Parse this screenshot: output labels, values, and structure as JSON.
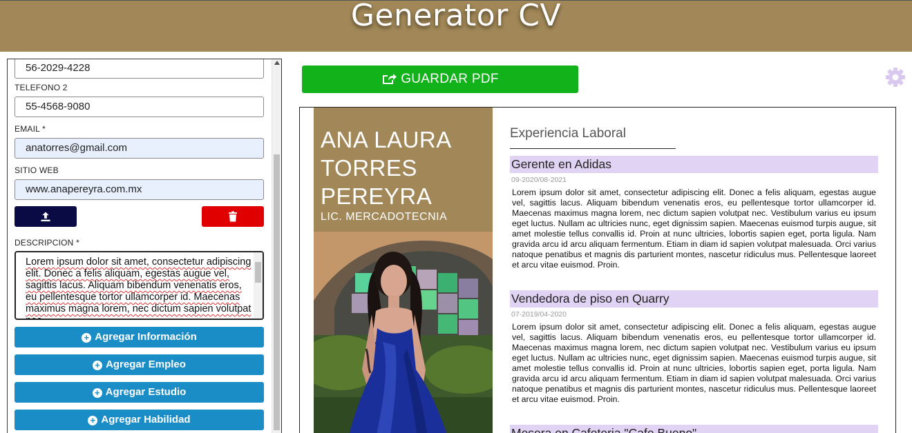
{
  "header": {
    "title": "Generator CV"
  },
  "form": {
    "phone1_value": "56-2029-4228",
    "phone2_label": "TELEFONO 2",
    "phone2_value": "55-4568-9080",
    "email_label": "EMAIL *",
    "email_value": "anatorres@gmail.com",
    "website_label": "SITIO WEB",
    "website_value": "www.anapereyra.com.mx",
    "description_label": "DESCRIPCION *",
    "description_value": "Lorem ipsum dolor sit amet, consectetur adipiscing elit. Donec a felis aliquam, egestas augue vel, sagittis lacus. Aliquam bibendum venenatis eros, eu pellentesque tortor ullamcorper id. Maecenas maximus magna lorem, nec dictum sapien volutpat nec.",
    "upload_icon": "upload-icon",
    "delete_icon": "trash-icon",
    "buttons": {
      "add_info": "Agregar Información",
      "add_job": "Agregar Empleo",
      "add_study": "Agregar Estudio",
      "add_skill": "Agregar Habilidad"
    }
  },
  "toolbar": {
    "pdf_label": "GUARDAR PDF",
    "pdf_icon": "share-icon",
    "settings_icon": "gear-icon"
  },
  "colors": {
    "header": "#a28858",
    "pdf_button": "#12b21a",
    "add_button": "#1a8dc6",
    "upload_button": "#0a0a45",
    "delete_button": "#e00000",
    "job_highlight": "#e1d3f3",
    "settings_gear": "#d9c8f0"
  },
  "cv": {
    "name_line1": "ANA LAURA",
    "name_line2": "TORRES",
    "name_line3": "PEREYRA",
    "degree": "LIC. MERCADOTECNIA",
    "experience_title": "Experiencia Laboral",
    "jobs": [
      {
        "title": "Gerente en Adidas",
        "dates": "09-2020/08-2021",
        "description": "Lorem ipsum dolor sit amet, consectetur adipiscing elit. Donec a felis aliquam, egestas augue vel, sagittis lacus. Aliquam bibendum venenatis eros, eu pellentesque tortor ullamcorper id. Maecenas maximus magna lorem, nec dictum sapien volutpat nec. Vestibulum varius eu ipsum eget luctus. Nullam ac ultricies nunc, eget dignissim sapien. Maecenas euismod turpis augue, sit amet molestie tellus convallis id. Proin at nunc ultricies, lobortis sapien eget, porta ligula. Nam gravida arcu id arcu aliquam fermentum. Etiam in diam id sapien volutpat malesuada. Orci varius natoque penatibus et magnis dis parturient montes, nascetur ridiculus mus. Pellentesque laoreet et arcu vitae euismod. Proin."
      },
      {
        "title": "Vendedora de piso en Quarry",
        "dates": "07-2019/04-2020",
        "description": "Lorem ipsum dolor sit amet, consectetur adipiscing elit. Donec a felis aliquam, egestas augue vel, sagittis lacus. Aliquam bibendum venenatis eros, eu pellentesque tortor ullamcorper id. Maecenas maximus magna lorem, nec dictum sapien volutpat nec. Vestibulum varius eu ipsum eget luctus. Nullam ac ultricies nunc, eget dignissim sapien. Maecenas euismod turpis augue, sit amet molestie tellus convallis id. Proin at nunc ultricies, lobortis sapien eget, porta ligula. Nam gravida arcu id arcu aliquam fermentum. Etiam in diam id sapien volutpat malesuada. Orci varius natoque penatibus et magnis dis parturient montes, nascetur ridiculus mus. Pellentesque laoreet et arcu vitae euismod. Proin."
      },
      {
        "title": "Mesera en Cafeteria \"Cafe Bueno\""
      }
    ]
  }
}
